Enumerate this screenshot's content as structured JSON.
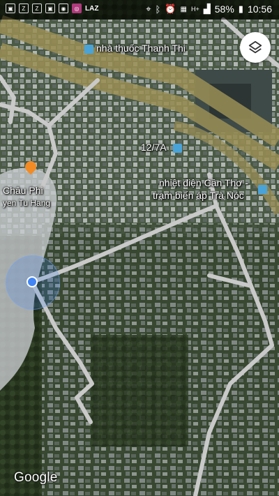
{
  "status_bar": {
    "left_icons": [
      "image-icon",
      "zalo-icon",
      "zalo-icon",
      "image-icon",
      "camera-icon",
      "instagram-icon",
      "laz-icon"
    ],
    "laz_label": "LAZ",
    "network": "H+",
    "battery": "58%",
    "time": "10:56"
  },
  "map": {
    "labels": {
      "pharmacy": "nhà thuốc Thanh Thi",
      "bus_stop": "12/7A",
      "power_station_line1": "nhiệt điện Cần Thơ -",
      "power_station_line2": "trạm biến áp Trà Nóc",
      "restaurant_line1": "Châu Phi",
      "restaurant_line2": "yen Tu Hang"
    },
    "watermark": "Google",
    "layers_button_icon": "layers-icon"
  },
  "colors": {
    "highway_fill": "#9a8e55",
    "road": "#c9c9c9",
    "location_blue": "#4285f4",
    "transit_icon": "#4aa3d8",
    "restaurant_icon": "#f28b24"
  }
}
